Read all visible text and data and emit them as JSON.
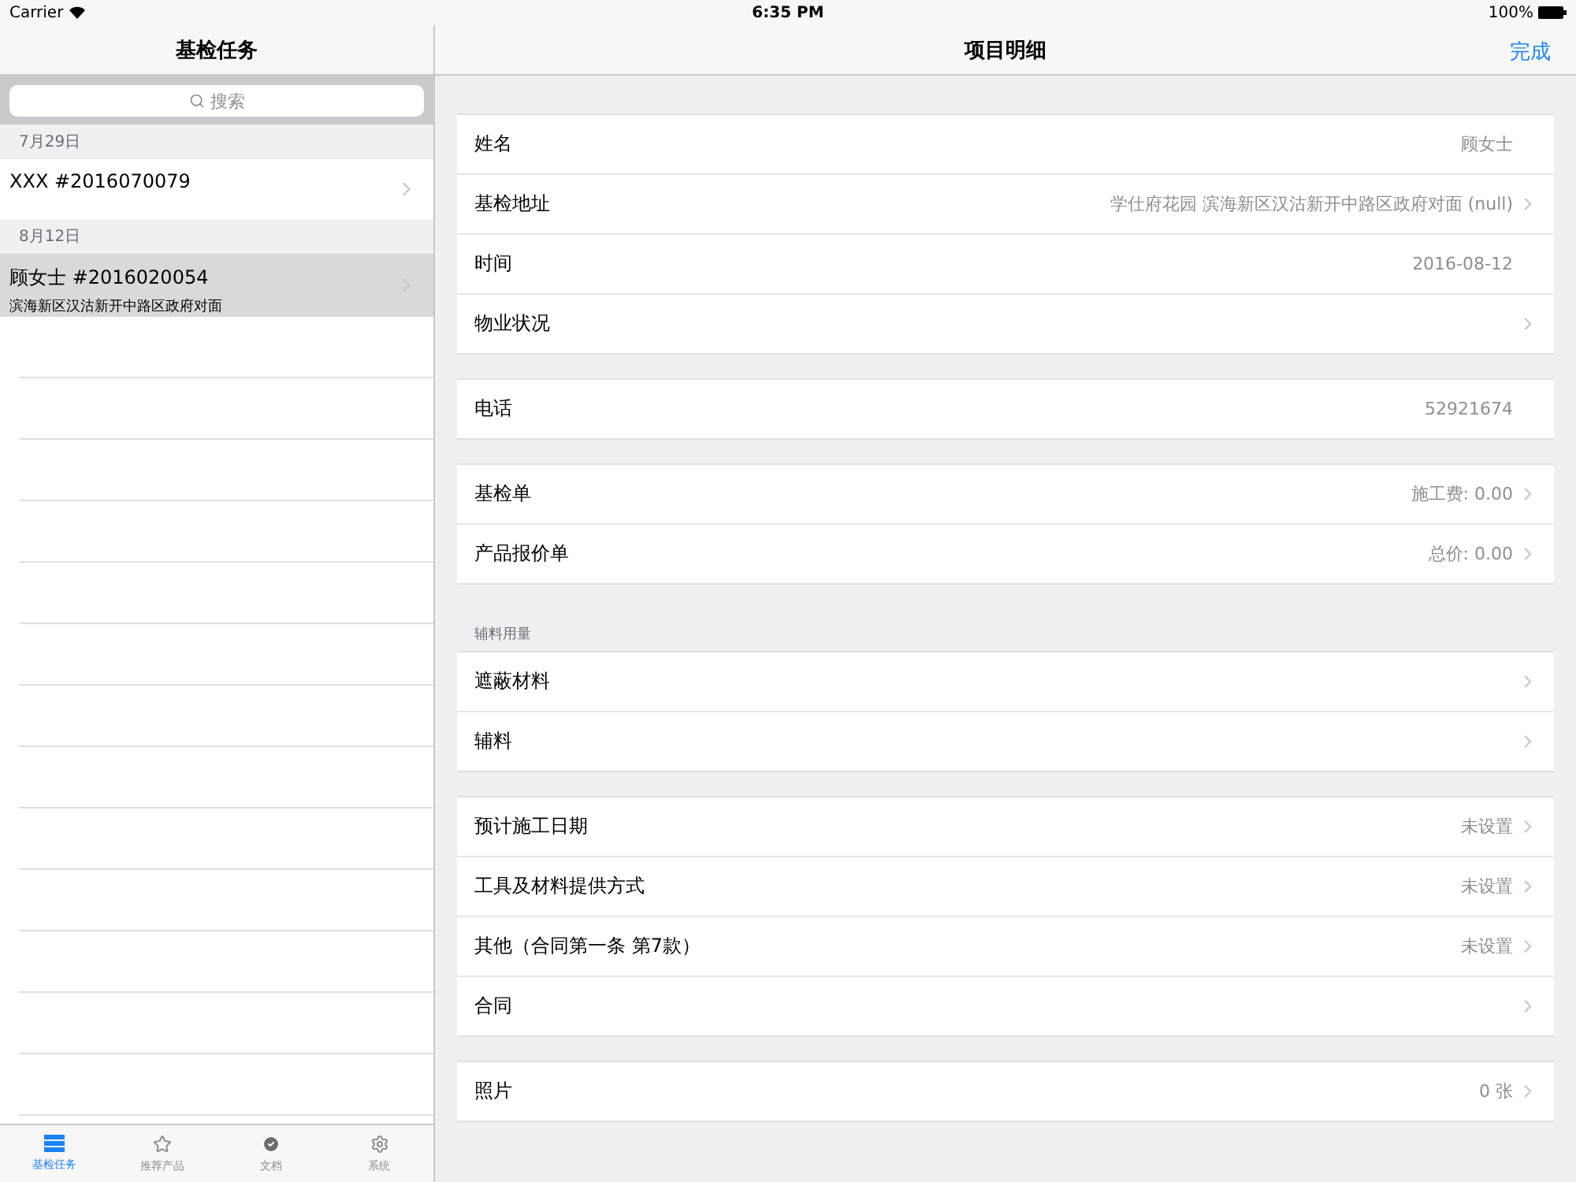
{
  "status_bar": {
    "carrier": "Carrier",
    "time": "6:35 PM",
    "battery": "100%"
  },
  "master": {
    "title": "基检任务",
    "search": {
      "placeholder": "搜索"
    },
    "sections": [
      {
        "header": "7月29日",
        "rows": [
          {
            "title": "XXX #2016070079",
            "selected": false
          }
        ]
      },
      {
        "header": "8月12日",
        "rows": [
          {
            "title": "顾女士 #2016020054",
            "subtitle": "滨海新区汉沽新开中路区政府对面",
            "selected": true
          }
        ]
      }
    ]
  },
  "tab_bar": [
    {
      "label": "基检任务",
      "selected": true
    },
    {
      "label": "推荐产品",
      "selected": false
    },
    {
      "label": "文档",
      "selected": false
    },
    {
      "label": "系统",
      "selected": false
    }
  ],
  "detail": {
    "title": "项目明细",
    "done": "完成",
    "groups": [
      {
        "rows": [
          {
            "label": "姓名",
            "value": "顾女士",
            "chevron": false
          },
          {
            "label": "基检地址",
            "value": "学仕府花园 滨海新区汉沽新开中路区政府对面 (null)",
            "chevron": true
          },
          {
            "label": "时间",
            "value": "2016-08-12",
            "chevron": false
          },
          {
            "label": "物业状况",
            "chevron": true
          }
        ]
      },
      {
        "rows": [
          {
            "label": "电话",
            "value": "52921674",
            "chevron": false
          }
        ]
      },
      {
        "rows": [
          {
            "label": "基检单",
            "value": "施工费: 0.00",
            "chevron": true
          },
          {
            "label": "产品报价单",
            "value": "总价: 0.00",
            "chevron": true
          }
        ]
      },
      {
        "header": "辅料用量",
        "rows": [
          {
            "label": "遮蔽材料",
            "chevron": true
          },
          {
            "label": "辅料",
            "chevron": true
          }
        ]
      },
      {
        "rows": [
          {
            "label": "预计施工日期",
            "value": "未设置",
            "chevron": true
          },
          {
            "label": "工具及材料提供方式",
            "value": "未设置",
            "chevron": true
          },
          {
            "label": "其他（合同第一条 第7款）",
            "value": "未设置",
            "chevron": true
          },
          {
            "label": "合同",
            "chevron": true
          }
        ]
      },
      {
        "rows": [
          {
            "label": "照片",
            "value": "0 张",
            "chevron": true
          }
        ]
      }
    ]
  }
}
